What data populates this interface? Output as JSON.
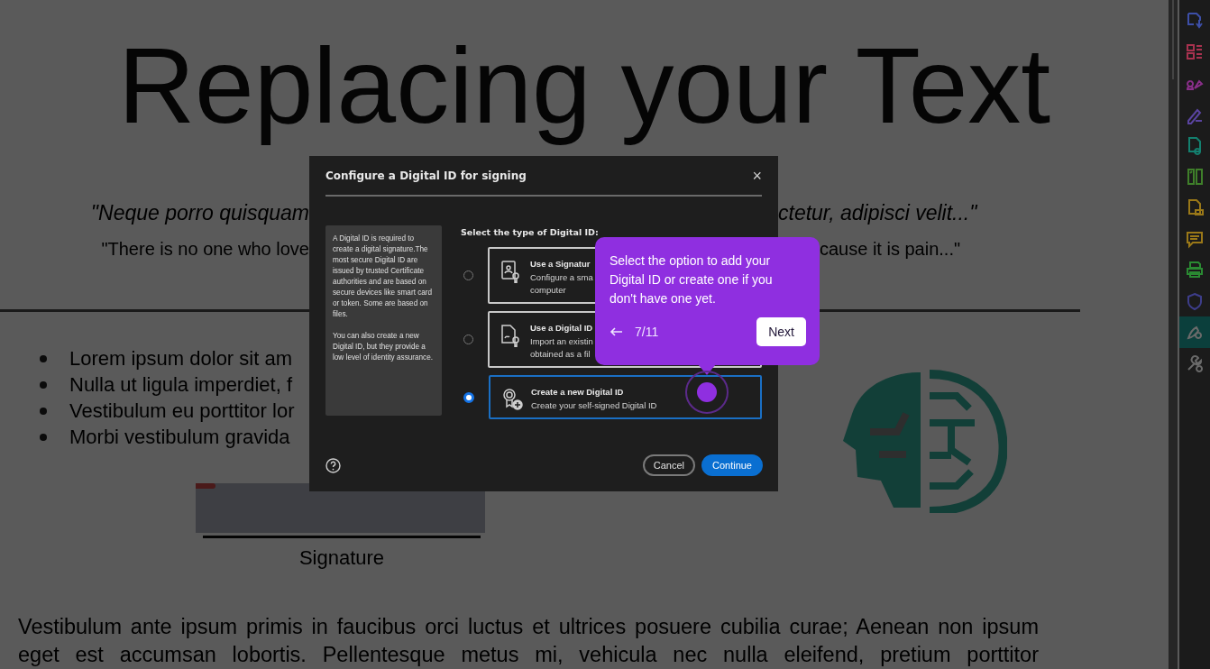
{
  "document": {
    "title": "Replacing your Text",
    "quotes": [
      {
        "kind": "italic",
        "left": "\"Neque porro quisquam",
        "right": "ctetur, adipisci velit...\""
      },
      {
        "kind": "plain",
        "left": "\"There is no one who love",
        "right": "cause it is pain...\""
      }
    ],
    "bullets": [
      "Lorem ipsum dolor sit am",
      "Nulla ut ligula imperdiet, f",
      "Vestibulum eu porttitor lor",
      "Morbi vestibulum gravida"
    ],
    "signature_label": "Signature",
    "paragraph": "Vestibulum ante ipsum primis in faucibus orci luctus et ultrices posuere cubilia curae; Aenean non ipsum eget est accumsan lobortis. Pellentesque metus mi, vehicula nec nulla eleifend, pretium porttitor"
  },
  "dialog": {
    "title": "Configure a Digital ID for signing",
    "close": "×",
    "info": [
      "A Digital ID is required to create a digital signature.The most secure Digital ID are issued by trusted Certificate authorities and are based on secure devices like smart card or token. Some are based on files.",
      "You can also create a new Digital ID, but they provide a low level of identity assurance."
    ],
    "prompt": "Select the type of Digital ID:",
    "options": [
      {
        "kind": "card",
        "title": "Use a Signatur",
        "description": [
          "Configure a sma",
          "computer"
        ],
        "selected": false
      },
      {
        "kind": "file",
        "title": "Use a Digital ID",
        "description": [
          "Import an existin",
          "obtained as a fil"
        ],
        "selected": false
      },
      {
        "kind": "new",
        "title": "Create a new Digital ID",
        "description": [
          "Create your self-signed Digital ID"
        ],
        "selected": true
      }
    ],
    "buttons": [
      {
        "kind": "secondary",
        "label": "Cancel"
      },
      {
        "kind": "primary",
        "label": "Continue"
      }
    ]
  },
  "tour_tip": {
    "text": "Select the option to add your Digital ID or create one if you don't have one yet.",
    "step": "7/11",
    "next": "Next"
  },
  "tool_rail": [
    {
      "color": "#3d4fa8",
      "selected": false
    },
    {
      "color": "#a8324f",
      "selected": false
    },
    {
      "color": "#8a2f8a",
      "selected": false
    },
    {
      "color": "#5a44a0",
      "selected": false
    },
    {
      "color": "#13806f",
      "selected": false
    },
    {
      "color": "#3f7f2a",
      "selected": false
    },
    {
      "color": "#9a7818",
      "selected": false
    },
    {
      "color": "#9a7818",
      "selected": false
    },
    {
      "color": "#2a8a32",
      "selected": false
    },
    {
      "color": "#3d3d8a",
      "selected": false
    },
    {
      "color": "#6a6a6a",
      "selected": true
    },
    {
      "color": "#6a6a6a",
      "selected": false
    }
  ]
}
